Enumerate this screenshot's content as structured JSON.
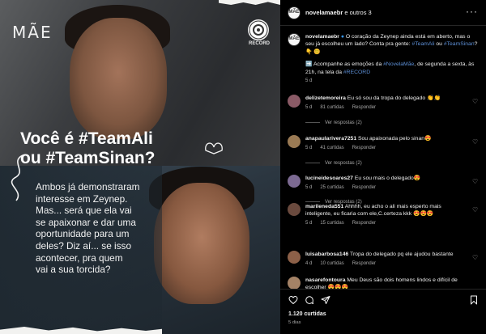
{
  "image": {
    "logo_left": "MÃE",
    "logo_right": "RECORD",
    "headline_line1": "Você é #TeamAli",
    "headline_line2": "ou #TeamSinan?",
    "body_lines": [
      "Ambos já demonstraram",
      "interesse em Zeynep.",
      "Mas... será que ela vai",
      "se apaixonar e dar uma",
      "oportunidade para um",
      "deles? Diz aí... se isso",
      "acontecer, pra quem",
      "vai a sua torcida?"
    ]
  },
  "header": {
    "username": "novelamaebr",
    "others": " e outros 3",
    "more_icon": "more-dots-icon"
  },
  "caption": {
    "username": "novelamaebr",
    "text_a": " O coração da Zeynep ainda está em aberto, mas o seu já escolheu um lado? Conta pra gente: ",
    "tag1": "#TeamAli",
    "text_b": " ou ",
    "tag2": "#TeamSinan",
    "text_c": "? 👇 😊",
    "para2_a": "➡️ Acompanhe as emoções da ",
    "tag3": "#NovelaMãe",
    "para2_b": ", de segunda a sexta, às 21h, na tela da ",
    "tag4": "#RECORD",
    "time": "5 d"
  },
  "comments": [
    {
      "username": "delizetemoreira",
      "text": " Eu só sou da tropa do delegado 👏👏",
      "time": "5 d",
      "likes": "81 curtidas",
      "reply": "Responder",
      "replies": "Ver respostas (2)",
      "avatar_color": "#8a5a66"
    },
    {
      "username": "anapaularivera7251",
      "text": " Sou apaixonada pelo sinan😍",
      "time": "5 d",
      "likes": "41 curtidas",
      "reply": "Responder",
      "replies": "Ver respostas (2)",
      "avatar_color": "#9a7a54"
    },
    {
      "username": "lucineidesoares27",
      "text": " Eu sou mais o delegado😍",
      "time": "5 d",
      "likes": "25 curtidas",
      "reply": "Responder",
      "replies": "Ver respostas (2)",
      "avatar_color": "#7c6a92"
    },
    {
      "username": "marileneda551",
      "text": " Ahhhh, eu acho o ali mais esperto mais inteligente, eu ficaria com ele,C.certeza kkk 😍😍😍",
      "time": "5 d",
      "likes": "15 curtidas",
      "reply": "Responder",
      "replies": "",
      "avatar_color": "#6a4a3e"
    },
    {
      "username": "luisabarbosa146",
      "text": " Tropa do delegado pq ele ajudou bastante",
      "time": "4 d",
      "likes": "10 curtidas",
      "reply": "Responder",
      "replies": "",
      "avatar_color": "#8c6048"
    },
    {
      "username": "nasarefontoura",
      "text": " Meu Deus são dois homens lindos e difícil de escolher 😍😍😍",
      "time": "",
      "likes": "",
      "reply": "",
      "replies": "",
      "avatar_color": "#a48266"
    }
  ],
  "actions": {
    "icons": [
      "heart-icon",
      "comment-icon",
      "share-icon",
      "bookmark-icon"
    ],
    "likes": "1.120 curtidas",
    "time": "5 dias"
  },
  "colors": {
    "background": "#000000",
    "link": "#5d8fd6",
    "muted": "#a8a8a8"
  }
}
